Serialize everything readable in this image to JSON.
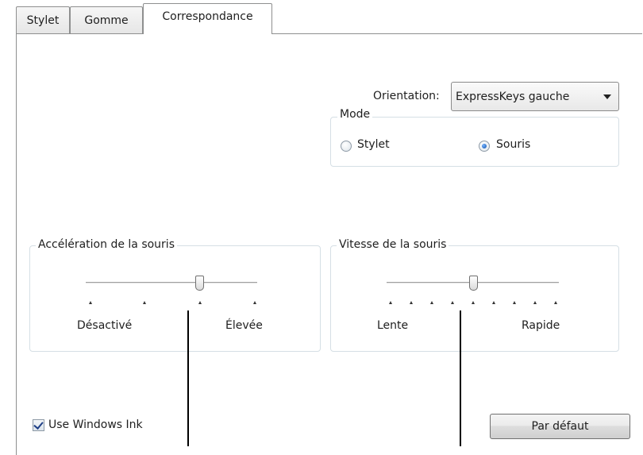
{
  "tabs": [
    {
      "label": "Stylet",
      "active": false
    },
    {
      "label": "Gomme",
      "active": false
    },
    {
      "label": "Correspondance",
      "active": true
    }
  ],
  "orientation": {
    "label": "Orientation:",
    "value": "ExpressKeys gauche"
  },
  "mode": {
    "legend": "Mode",
    "options": [
      {
        "label": "Stylet",
        "checked": false
      },
      {
        "label": "Souris",
        "checked": true
      }
    ]
  },
  "acceleration": {
    "legend": "Accélération de la souris",
    "min_label": "Désactivé",
    "max_label": "Élevée",
    "ticks": 4,
    "value_index": 2
  },
  "speed": {
    "legend": "Vitesse de la souris",
    "min_label": "Lente",
    "max_label": "Rapide",
    "ticks": 9,
    "value_index": 4
  },
  "windows_ink": {
    "label": "Use Windows Ink",
    "checked": true
  },
  "default_button": {
    "label": "Par défaut"
  }
}
